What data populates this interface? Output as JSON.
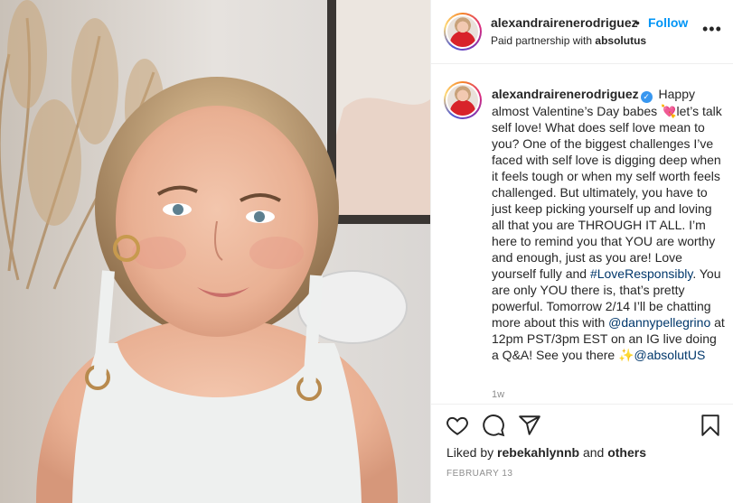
{
  "header": {
    "username": "alexandrairenerodriguez",
    "follow_label": "Follow",
    "separator": "•",
    "partnership_prefix": "Paid partnership with",
    "partner": "absolutus",
    "more_label": "•••"
  },
  "caption": {
    "username": "alexandrairenerodriguez",
    "text_1": "Happy almost Valentine’s Day babes 💘let’s talk self love! What does self love mean to you? One of the biggest challenges I’ve faced with self love is digging deep when it feels tough or when my self worth feels challenged. But ultimately, you have to just keep picking yourself up and loving all that you are THROUGH IT ALL. I’m here to remind you that YOU are worthy and enough, just as you are! Love yourself fully and ",
    "hashtag": "#LoveResponsibly",
    "text_2": ". You are only YOU there is, that’s pretty powerful. Tomorrow 2/14 I’ll be chatting more about this with ",
    "mention_1": "@dannypellegrino",
    "text_3": " at 12pm PST/3pm EST on an IG live doing a Q&A! See you there ✨",
    "mention_2": "@absolutUS",
    "time_ago": "1w"
  },
  "footer": {
    "liked_prefix": "Liked by",
    "liked_user": "rebekahlynnb",
    "liked_and": "and",
    "liked_others": "others",
    "date": "FEBRUARY 13"
  },
  "icons": {
    "heart": "heart-icon",
    "comment": "comment-icon",
    "share": "share-icon",
    "save": "bookmark-icon",
    "verified": "verified-badge-icon"
  },
  "colors": {
    "accent": "#0095f6",
    "link": "#00376b",
    "muted": "#8e8e8e",
    "text": "#262626"
  }
}
